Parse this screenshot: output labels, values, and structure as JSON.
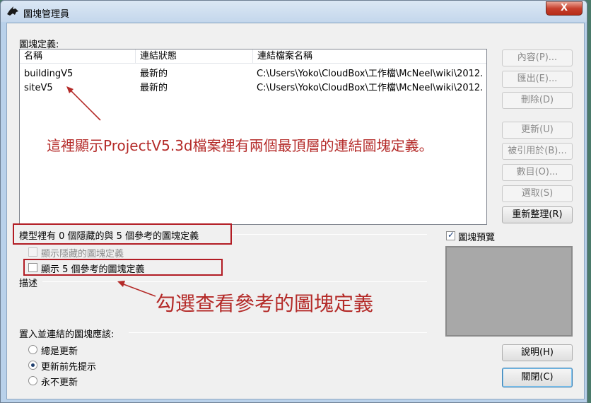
{
  "window": {
    "title": "圖塊管理員",
    "close_glyph": "X"
  },
  "block_definitions_label": "圖塊定義:",
  "table": {
    "columns": [
      "名稱",
      "連結狀態",
      "連結檔案名稱"
    ],
    "rows": [
      [
        "buildingV5",
        "最新的",
        "C:\\Users\\Yoko\\CloudBox\\工作檔\\McNeel\\wiki\\2012..."
      ],
      [
        "siteV5",
        "最新的",
        "C:\\Users\\Yoko\\CloudBox\\工作檔\\McNeel\\wiki\\2012..."
      ]
    ]
  },
  "buttons": {
    "properties": "內容(P)...",
    "export": "匯出(E)...",
    "delete": "刪除(D)",
    "update": "更新(U)",
    "used_in": "被引用於(B)...",
    "count": "數目(O)...",
    "select": "選取(S)",
    "rebuild": "重新整理(R)",
    "help": "說明(H)",
    "close": "關閉(C)"
  },
  "model_info": "模型裡有 0 個隱藏的與 5 個參考的圖塊定義",
  "show_hidden": {
    "label": "顯示隱藏的圖塊定義",
    "checked": false,
    "enabled": false
  },
  "show_reference": {
    "label": "顯示 5 個參考的圖塊定義",
    "checked": false,
    "enabled": true
  },
  "description_label": "描述",
  "insert_label": "置入並連結的圖塊應該:",
  "update_options": [
    {
      "label": "總是更新",
      "checked": false
    },
    {
      "label": "更新前先提示",
      "checked": true
    },
    {
      "label": "永不更新",
      "checked": false
    }
  ],
  "preview": {
    "label": "圖塊預覽",
    "checked": true
  },
  "annotations": {
    "top": "這裡顯示ProjectV5.3d檔案裡有兩個最頂層的連結圖塊定義。",
    "bottom": "勾選查看參考的圖塊定義"
  },
  "colors": {
    "annotation": "#b42a28",
    "close_button": "#c7402d"
  }
}
